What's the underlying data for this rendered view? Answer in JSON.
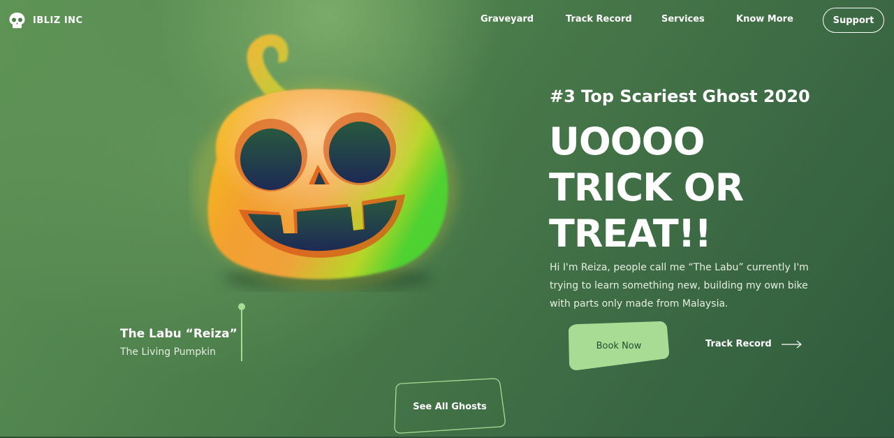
{
  "brand": {
    "name": "IBLIZ INC"
  },
  "nav": {
    "links": [
      "Graveyard",
      "Track Record",
      "Services",
      "Know More"
    ],
    "support_label": "Support"
  },
  "hero": {
    "kicker": "#3 Top Scariest Ghost 2020",
    "title_lines": [
      "UOOOO",
      "TRICK OR",
      "TREAT!!"
    ],
    "description": "Hi I'm Reiza, people call me “The Labu” currently I'm trying to learn something new, building my own bike with parts only made from Malaysia.",
    "book_label": "Book Now",
    "track_label": "Track Record"
  },
  "caption": {
    "name": "The Labu “Reiza”",
    "subtitle": "The Living Pumpkin"
  },
  "see_all_label": "See All Ghosts",
  "colors": {
    "background": "#3f6e46",
    "accent": "#a8dc94",
    "button_text": "#1f4e31",
    "text": "#ffffff"
  },
  "icons": {
    "logo": "skull-icon",
    "track_arrow": "arrow-right-icon",
    "hero_image": "jack-o-lantern-pumpkin"
  }
}
